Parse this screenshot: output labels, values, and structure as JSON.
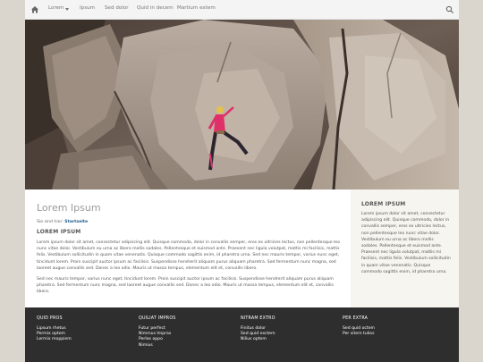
{
  "nav": {
    "items": [
      "Lorem",
      "Ipsum",
      "Sed dolor",
      "Quid in decem",
      "Martium extem"
    ]
  },
  "hero": {
    "alt": ""
  },
  "main": {
    "title": "Lorem Ipsum",
    "breadcrumb_prefix": "Sie sind hier:",
    "breadcrumb_current": "Startseite",
    "heading": "LOREM IPSUM",
    "paragraphs": [
      "Lorem ipsum dolor sit amet, consectetur adipiscing elit. Quisque commodo, dolor in convallis semper, eros ex ultricies lectus, non pellentesque leo nunc vitae dolor. Vestibulum eu urna ac libero mollis sodales. Pellentesque et euismod ante. Praesent nec ligula volutpat, mattis mi facilisis, mattis felis. Vestibulum sollicitudin in quam vitae venenatis. Quisque commodo sagittis enim, id pharetra urna. Sed nec mauris tempor, varius nunc eget, tincidunt lorem. Proin suscipit auctor ipsum ac facilisis. Suspendisse hendrerit aliquam purus aliquam pharetra. Sed fermentum nunc magna, sed laoreet augue convallis sed. Donec a leo odio. Mauris ut massa tempus, elementum elit et, convallis libero.",
      "Sed nec mauris tempor, varius nunc eget, tincidunt lorem. Proin suscipit auctor ipsum ac facilisis. Suspendisse hendrerit aliquam purus aliquam pharetra. Sed fermentum nunc magna, sed laoreet augue convallis sed. Donec a leo odio. Mauris ut massa tempus, elementum elit et, convallis libero."
    ]
  },
  "sidebar": {
    "heading": "LOREM IPSUM",
    "text": "Lorem ipsum dolor sit amet, consectetur adipiscing elit. Quisque commodo, dolor in convallis semper, eros ex ultricies lectus, non pellentesque leo nunc vitae dolor. Vestibulum eu urna ac libero mollis sodales. Pellentesque et euismod ante. Praesent nec ligula volutpat, mattis mi facilisis, mattis felis. Vestibulum sollicitudin in quam vitae venenatis. Quisque commodo sagittis enim, id pharetra urna."
  },
  "footer": {
    "columns": [
      {
        "heading": "QUID PROS",
        "links": [
          "Lipsum rhetus",
          "Permix optem",
          "Lermix moppiem"
        ]
      },
      {
        "heading": "QUILIAT IMPROS",
        "links": [
          "Futur perfect",
          "Nimmus Impras",
          "Perlox oppo",
          "Nimius"
        ]
      },
      {
        "heading": "NITRAM EXTRO",
        "links": [
          "Finitus dolor",
          "Sed quid exctem",
          "Nilius optem"
        ]
      },
      {
        "heading": "PER EXTRA",
        "links": [
          "Sed quid octem",
          "Per sitem tulios"
        ]
      }
    ]
  },
  "colors": {
    "page_bg": "#dad6cd",
    "footer_bg": "#2e2e2e",
    "sidebar_bg": "#f7f5ef",
    "link": "#1d5a8a",
    "climber_shirt": "#e0306a"
  },
  "icons": {
    "home": "home-icon",
    "search": "search-icon",
    "dropdown": "caret-down-icon"
  }
}
